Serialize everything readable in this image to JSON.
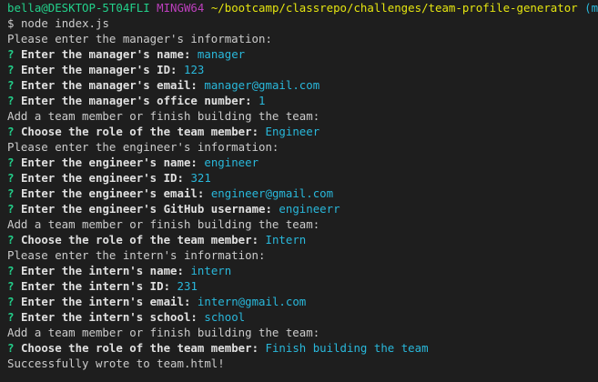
{
  "prompt": {
    "user_host": "bella@DESKTOP-5T04FLI",
    "shell": "MINGW64",
    "path": "~/bootcamp/classrepo/challenges/team-profile-generator",
    "branch": "(main)"
  },
  "command": {
    "symbol": "$",
    "text": "node index.js"
  },
  "colors": {
    "background": "#1e1e1e",
    "user_host": "#23d18b",
    "shell": "#bc3fbc",
    "path": "#e5e510",
    "branch": "#29b8db",
    "question_mark": "#23d18b",
    "answer": "#29b8db",
    "text": "#cccccc"
  },
  "lines": [
    {
      "type": "plain",
      "text": "Please enter the manager's information:"
    },
    {
      "type": "q",
      "q": "?",
      "question": "Enter the manager's name:",
      "answer": "manager"
    },
    {
      "type": "q",
      "q": "?",
      "question": "Enter the manager's ID:",
      "answer": "123"
    },
    {
      "type": "q",
      "q": "?",
      "question": "Enter the manager's email:",
      "answer": "manager@gmail.com"
    },
    {
      "type": "q",
      "q": "?",
      "question": "Enter the manager's office number:",
      "answer": "1"
    },
    {
      "type": "plain",
      "text": "Add a team member or finish building the team:"
    },
    {
      "type": "q",
      "q": "?",
      "question": "Choose the role of the team member:",
      "answer": "Engineer"
    },
    {
      "type": "plain",
      "text": "Please enter the engineer's information:"
    },
    {
      "type": "q",
      "q": "?",
      "question": "Enter the engineer's name:",
      "answer": "engineer"
    },
    {
      "type": "q",
      "q": "?",
      "question": "Enter the engineer's ID:",
      "answer": "321"
    },
    {
      "type": "q",
      "q": "?",
      "question": "Enter the engineer's email:",
      "answer": "engineer@gmail.com"
    },
    {
      "type": "q",
      "q": "?",
      "question": "Enter the engineer's GitHub username:",
      "answer": "engineerr"
    },
    {
      "type": "plain",
      "text": "Add a team member or finish building the team:"
    },
    {
      "type": "q",
      "q": "?",
      "question": "Choose the role of the team member:",
      "answer": "Intern"
    },
    {
      "type": "plain",
      "text": "Please enter the intern's information:"
    },
    {
      "type": "q",
      "q": "?",
      "question": "Enter the intern's name:",
      "answer": "intern"
    },
    {
      "type": "q",
      "q": "?",
      "question": "Enter the intern's ID:",
      "answer": "231"
    },
    {
      "type": "q",
      "q": "?",
      "question": "Enter the intern's email:",
      "answer": "intern@gmail.com"
    },
    {
      "type": "q",
      "q": "?",
      "question": "Enter the intern's school:",
      "answer": "school"
    },
    {
      "type": "plain",
      "text": "Add a team member or finish building the team:"
    },
    {
      "type": "q",
      "q": "?",
      "question": "Choose the role of the team member:",
      "answer": "Finish building the team"
    },
    {
      "type": "plain",
      "text": "Successfully wrote to team.html!"
    }
  ]
}
